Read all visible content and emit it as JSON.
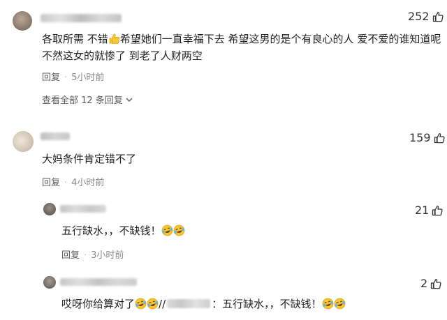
{
  "comments": [
    {
      "content_lines": [
        "各取所需 不错",
        "希望她们一直幸福下去 希望这男的是个有良心的人 爱不爱的谁知道呢",
        "不然这女的就惨了 到老了人财两空"
      ],
      "reply_label": "回复",
      "time": "5小时前",
      "likes": "252",
      "view_all": "查看全部 12 条回复"
    },
    {
      "content": "大妈条件肯定错不了",
      "reply_label": "回复",
      "time": "4小时前",
      "likes": "159"
    },
    {
      "content": "五行缺水，，不缺钱！",
      "reply_label": "回复",
      "time": "3小时前",
      "likes": "21"
    },
    {
      "content_prefix": "哎呀你给算对了",
      "content_sep": "//",
      "content_suffix": "：五行缺水，，不缺钱！",
      "likes": "2"
    }
  ],
  "icons": [
    "thumbs-up-icon",
    "laughing-crying-emoji",
    "chevron-down-icon"
  ]
}
